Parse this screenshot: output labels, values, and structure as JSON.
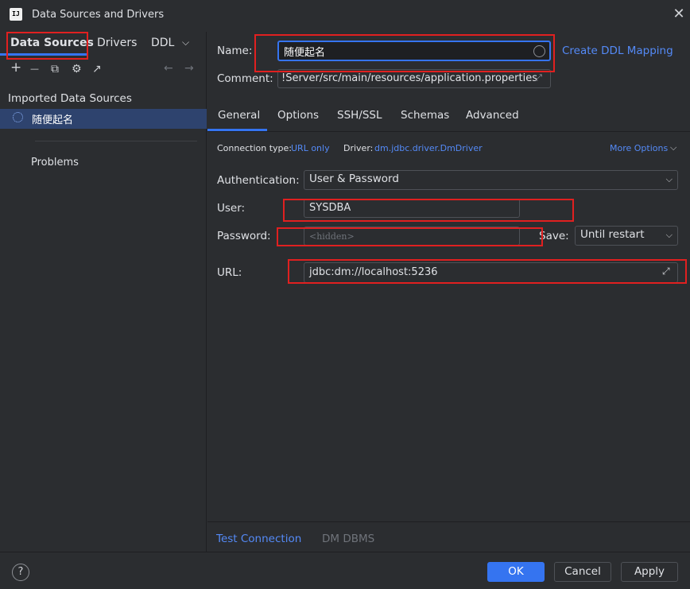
{
  "window": {
    "title": "Data Sources and Drivers",
    "logo_text": "IJ",
    "close_glyph": "✕"
  },
  "left": {
    "tabs": [
      {
        "label": "Data Sources",
        "selected": true
      },
      {
        "label": "Drivers"
      },
      {
        "label": "DDL"
      }
    ],
    "more_tabs_glyph": "⌵",
    "toolbar": {
      "add": "+",
      "remove": "—",
      "duplicate": "⧉",
      "settings": "⚙",
      "export": "↗",
      "back": "←",
      "forward": "→"
    },
    "section_header": "Imported Data Sources",
    "items": [
      {
        "label": "随便起名",
        "selected": true
      }
    ],
    "problems_label": "Problems"
  },
  "form": {
    "name_label": "Name:",
    "name_value": "随便起名",
    "create_ddl_link": "Create DDL Mapping",
    "comment_label": "Comment:",
    "comment_value": "!Server/src/main/resources/application.properties",
    "expand_glyph": "⤢",
    "tabs": [
      {
        "label": "General",
        "selected": true
      },
      {
        "label": "Options"
      },
      {
        "label": "SSH/SSL"
      },
      {
        "label": "Schemas"
      },
      {
        "label": "Advanced"
      }
    ],
    "connection_type_label": "Connection type:",
    "connection_type_value": "URL only",
    "driver_label": "Driver:",
    "driver_value": "dm.jdbc.driver.DmDriver",
    "more_options_link": "More Options",
    "more_options_arrow": "⌵",
    "auth_label": "Authentication:",
    "auth_value": "User & Password",
    "dropdown_arrow": "⌵",
    "user_label": "User:",
    "user_value": "SYSDBA",
    "password_label": "Password:",
    "password_placeholder": "<hidden>",
    "save_label": "Save:",
    "save_value": "Until restart",
    "url_label": "URL:",
    "url_value": "jdbc:dm://localhost:5236"
  },
  "bottom": {
    "test_connection": "Test Connection",
    "dbms_label": "DM DBMS",
    "help_glyph": "?",
    "ok": "OK",
    "cancel": "Cancel",
    "apply": "Apply"
  },
  "colors": {
    "background": "#2b2d30",
    "accent": "#3574f0",
    "link": "#548af7",
    "selection": "#2e436e",
    "annotation_red": "#e02020"
  }
}
